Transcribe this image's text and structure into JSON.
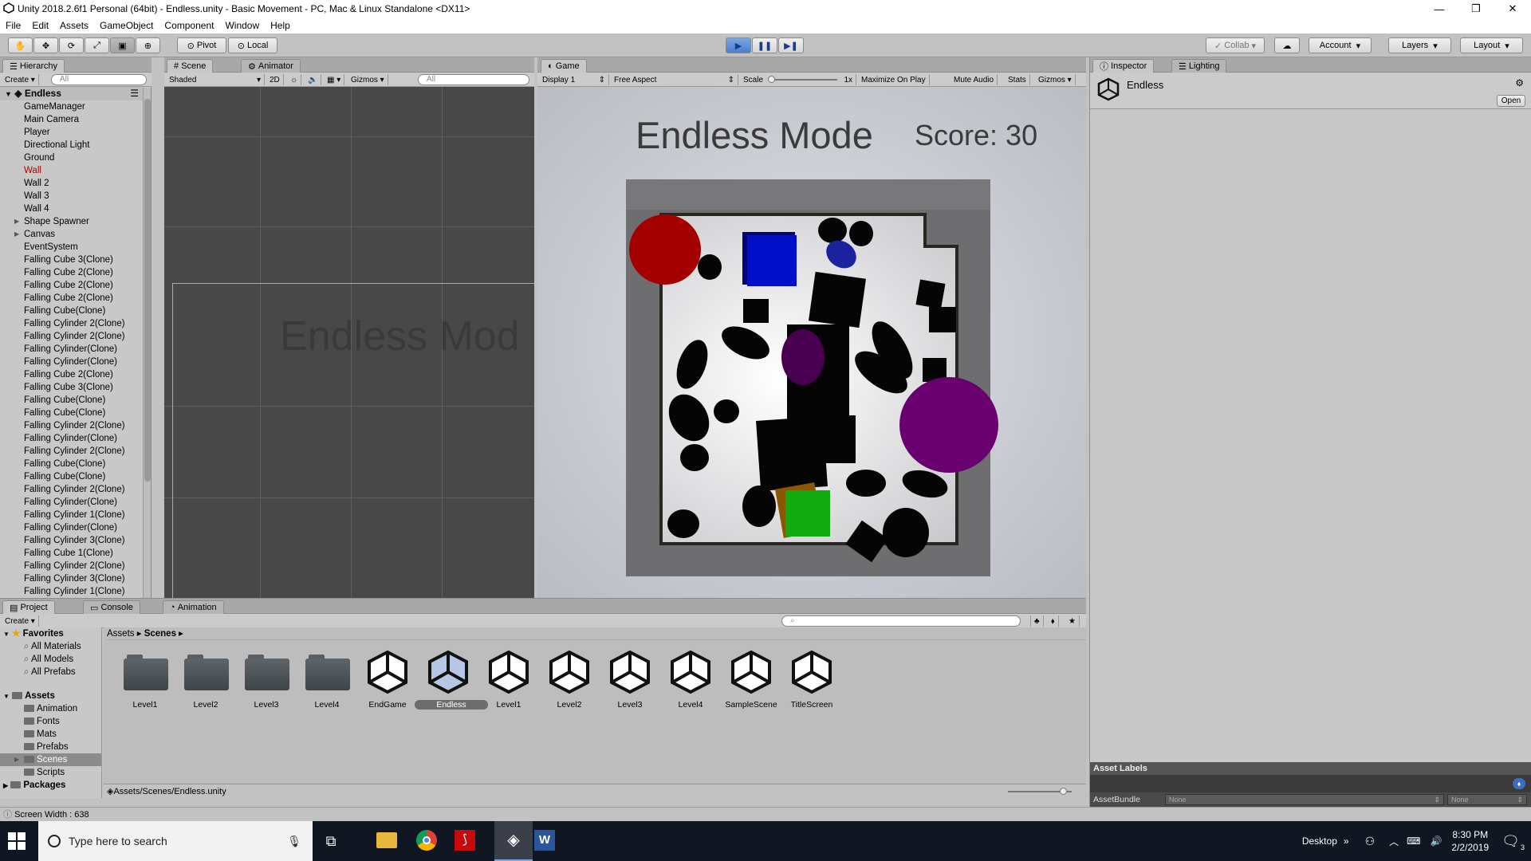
{
  "window": {
    "title": "Unity 2018.2.6f1 Personal (64bit) - Endless.unity - Basic Movement - PC, Mac & Linux Standalone <DX11>"
  },
  "menu": [
    "File",
    "Edit",
    "Assets",
    "GameObject",
    "Component",
    "Window",
    "Help"
  ],
  "toolbar": {
    "pivot": "Pivot",
    "local": "Local",
    "collab": "Collab",
    "account": "Account",
    "layers": "Layers",
    "layout": "Layout"
  },
  "hierarchy": {
    "tab": "Hierarchy",
    "create": "Create",
    "search_placeholder": "All",
    "scene": "Endless",
    "items": [
      "GameManager",
      "Main Camera",
      "Player",
      "Directional Light",
      "Ground",
      "Wall",
      "Wall 2",
      "Wall 3",
      "Wall 4",
      "Shape Spawner",
      "Canvas",
      "EventSystem",
      "Falling Cube 3(Clone)",
      "Falling Cube 2(Clone)",
      "Falling Cube 2(Clone)",
      "Falling Cube 2(Clone)",
      "Falling Cube(Clone)",
      "Falling Cylinder 2(Clone)",
      "Falling Cylinder 2(Clone)",
      "Falling Cylinder(Clone)",
      "Falling Cylinder(Clone)",
      "Falling Cube 2(Clone)",
      "Falling Cube 3(Clone)",
      "Falling Cube(Clone)",
      "Falling Cube(Clone)",
      "Falling Cylinder 2(Clone)",
      "Falling Cylinder(Clone)",
      "Falling Cylinder 2(Clone)",
      "Falling Cube(Clone)",
      "Falling Cube(Clone)",
      "Falling Cylinder 2(Clone)",
      "Falling Cylinder(Clone)",
      "Falling Cylinder 1(Clone)",
      "Falling Cylinder(Clone)",
      "Falling Cylinder 3(Clone)",
      "Falling Cube 1(Clone)",
      "Falling Cylinder 2(Clone)",
      "Falling Cylinder 3(Clone)",
      "Falling Cylinder 1(Clone)"
    ]
  },
  "scene": {
    "tab": "Scene",
    "tab2": "Animator",
    "shading": "Shaded",
    "mode2d": "2D",
    "gizmos": "Gizmos",
    "search_placeholder": "All",
    "overlay_text": "Endless Mod"
  },
  "game": {
    "tab": "Game",
    "display": "Display 1",
    "aspect": "Free Aspect",
    "scale_label": "Scale",
    "scale_value": "1x",
    "maximize": "Maximize On Play",
    "mute": "Mute Audio",
    "stats": "Stats",
    "gizmos": "Gizmos",
    "title": "Endless Mode",
    "score": "Score: 30"
  },
  "inspector": {
    "tab": "Inspector",
    "tab2": "Lighting",
    "object": "Endless",
    "open": "Open",
    "asset_labels": "Asset Labels",
    "assetbundle": "AssetBundle",
    "bundle_value": "None",
    "variant_value": "None"
  },
  "project": {
    "tab": "Project",
    "tab2": "Console",
    "tab3": "Animation",
    "create": "Create",
    "favorites": "Favorites",
    "fav_items": [
      "All Materials",
      "All Models",
      "All Prefabs"
    ],
    "assets": "Assets",
    "asset_folders": [
      "Animation",
      "Fonts",
      "Mats",
      "Prefabs",
      "Scenes",
      "Scripts"
    ],
    "packages": "Packages",
    "breadcrumb_root": "Assets",
    "breadcrumb_current": "Scenes",
    "items": [
      {
        "label": "Level1",
        "kind": "folder"
      },
      {
        "label": "Level2",
        "kind": "folder"
      },
      {
        "label": "Level3",
        "kind": "folder"
      },
      {
        "label": "Level4",
        "kind": "folder"
      },
      {
        "label": "EndGame",
        "kind": "scene"
      },
      {
        "label": "Endless",
        "kind": "scene"
      },
      {
        "label": "Level1",
        "kind": "scene"
      },
      {
        "label": "Level2",
        "kind": "scene"
      },
      {
        "label": "Level3",
        "kind": "scene"
      },
      {
        "label": "Level4",
        "kind": "scene"
      },
      {
        "label": "SampleScene",
        "kind": "scene"
      },
      {
        "label": "TitleScreen",
        "kind": "scene"
      }
    ],
    "path": "Assets/Scenes/Endless.unity"
  },
  "status": {
    "text": "Screen Width : 638"
  },
  "taskbar": {
    "search_placeholder": "Type here to search",
    "desktop": "Desktop",
    "time": "8:30 PM",
    "date": "2/2/2019",
    "notifications": "3"
  }
}
